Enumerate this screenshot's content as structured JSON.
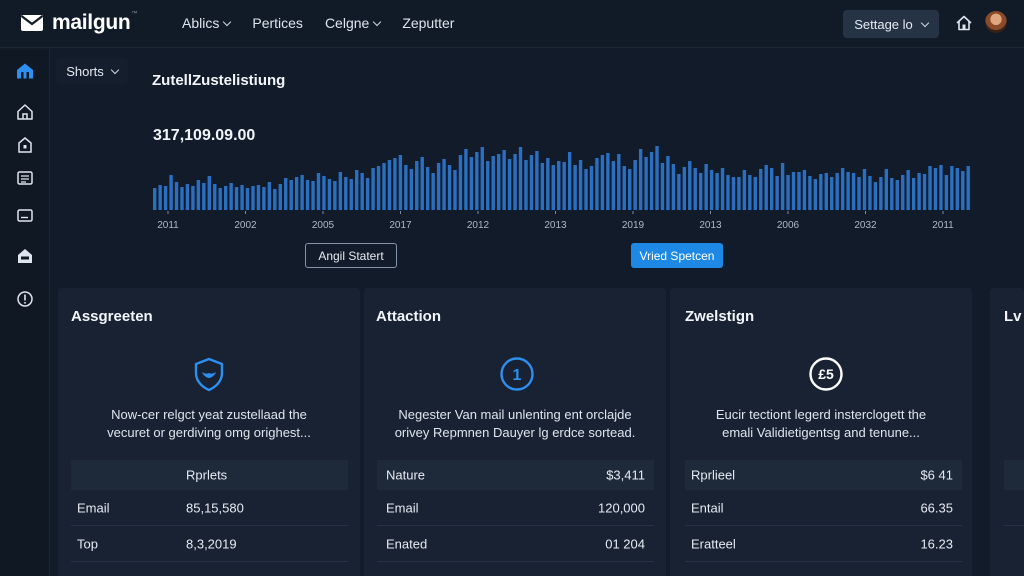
{
  "header": {
    "logo_text": "mailgun",
    "logo_mark": "™",
    "nav": [
      "Ablics",
      "Pertices",
      "Celgne",
      "Zeputter"
    ],
    "settings_label": "Settage lo"
  },
  "overview": {
    "filter_label": "Shorts",
    "title": "ZutellZustelistiung",
    "total": "317,109.09.00",
    "button_secondary": "Angil Statert",
    "button_primary": "Vried Spetcen"
  },
  "chart_data": {
    "type": "bar",
    "title": "ZutellZustelistiung",
    "xlabel": "",
    "ylabel": "",
    "x_ticks": [
      "2011",
      "2002",
      "2005",
      "2017",
      "2012",
      "2013",
      "2019",
      "2013",
      "2006",
      "2032",
      "2011"
    ],
    "ylim": [
      0,
      65
    ],
    "values": [
      22,
      25,
      24,
      35,
      28,
      23,
      26,
      24,
      30,
      27,
      34,
      26,
      22,
      24,
      27,
      23,
      25,
      22,
      24,
      25,
      23,
      28,
      21,
      26,
      32,
      30,
      33,
      35,
      30,
      29,
      37,
      34,
      31,
      29,
      38,
      33,
      31,
      40,
      37,
      32,
      42,
      44,
      47,
      50,
      52,
      55,
      45,
      41,
      49,
      53,
      43,
      37,
      47,
      51,
      45,
      40,
      55,
      61,
      53,
      58,
      63,
      49,
      54,
      56,
      60,
      51,
      56,
      63,
      50,
      55,
      59,
      47,
      52,
      45,
      49,
      48,
      58,
      45,
      50,
      41,
      44,
      52,
      55,
      57,
      49,
      56,
      44,
      41,
      50,
      61,
      53,
      58,
      64,
      47,
      54,
      46,
      36,
      43,
      49,
      42,
      37,
      46,
      40,
      37,
      42,
      35,
      33,
      33,
      40,
      35,
      33,
      41,
      45,
      42,
      34,
      47,
      35,
      38,
      38,
      40,
      34,
      31,
      36,
      37,
      33,
      37,
      42,
      38,
      37,
      33,
      41,
      34,
      28,
      33,
      41,
      32,
      30,
      35,
      40,
      32,
      37,
      36,
      44,
      42,
      45,
      35,
      44,
      42,
      39,
      44
    ]
  },
  "cards": [
    {
      "title": "Assgreeten",
      "icon": "shield-icon",
      "desc_lines": [
        "Now-cer relgct yeat zustellaad the",
        "vecuret or gerdiving omg orighest..."
      ],
      "header_center": "Rprlets",
      "header_right": "",
      "rows": [
        {
          "label": "Email",
          "value": "85,15,580"
        },
        {
          "label": "Top",
          "value": "8,3,2019"
        }
      ]
    },
    {
      "title": "Attaction",
      "icon": "number-one-icon",
      "icon_text": "1",
      "desc_lines": [
        "Negester Van mail unlenting ent orclajde",
        "orivey Repmnen Dauyer lg erdce sortead."
      ],
      "header_left": "Nature",
      "header_right": "$3,411",
      "rows": [
        {
          "label": "Email",
          "value": "120,000"
        },
        {
          "label": "Enated",
          "value": "01 204"
        }
      ]
    },
    {
      "title": "Zwelstign",
      "icon": "badge-icon",
      "icon_text": "£5",
      "desc_lines": [
        "Eucir tectiont legerd insterclogett the",
        "emali Validietigentsg and tenune..."
      ],
      "header_left": "Rprlieel",
      "header_right": "$6 41",
      "rows": [
        {
          "label": "Entail",
          "value": "66.35"
        },
        {
          "label": "Eratteel",
          "value": "16.23"
        }
      ]
    },
    {
      "title": "Lv"
    }
  ],
  "colors": {
    "accent": "#1e88e5",
    "bar": "#2a6fc0",
    "background": "#121b29",
    "card": "#182232"
  }
}
